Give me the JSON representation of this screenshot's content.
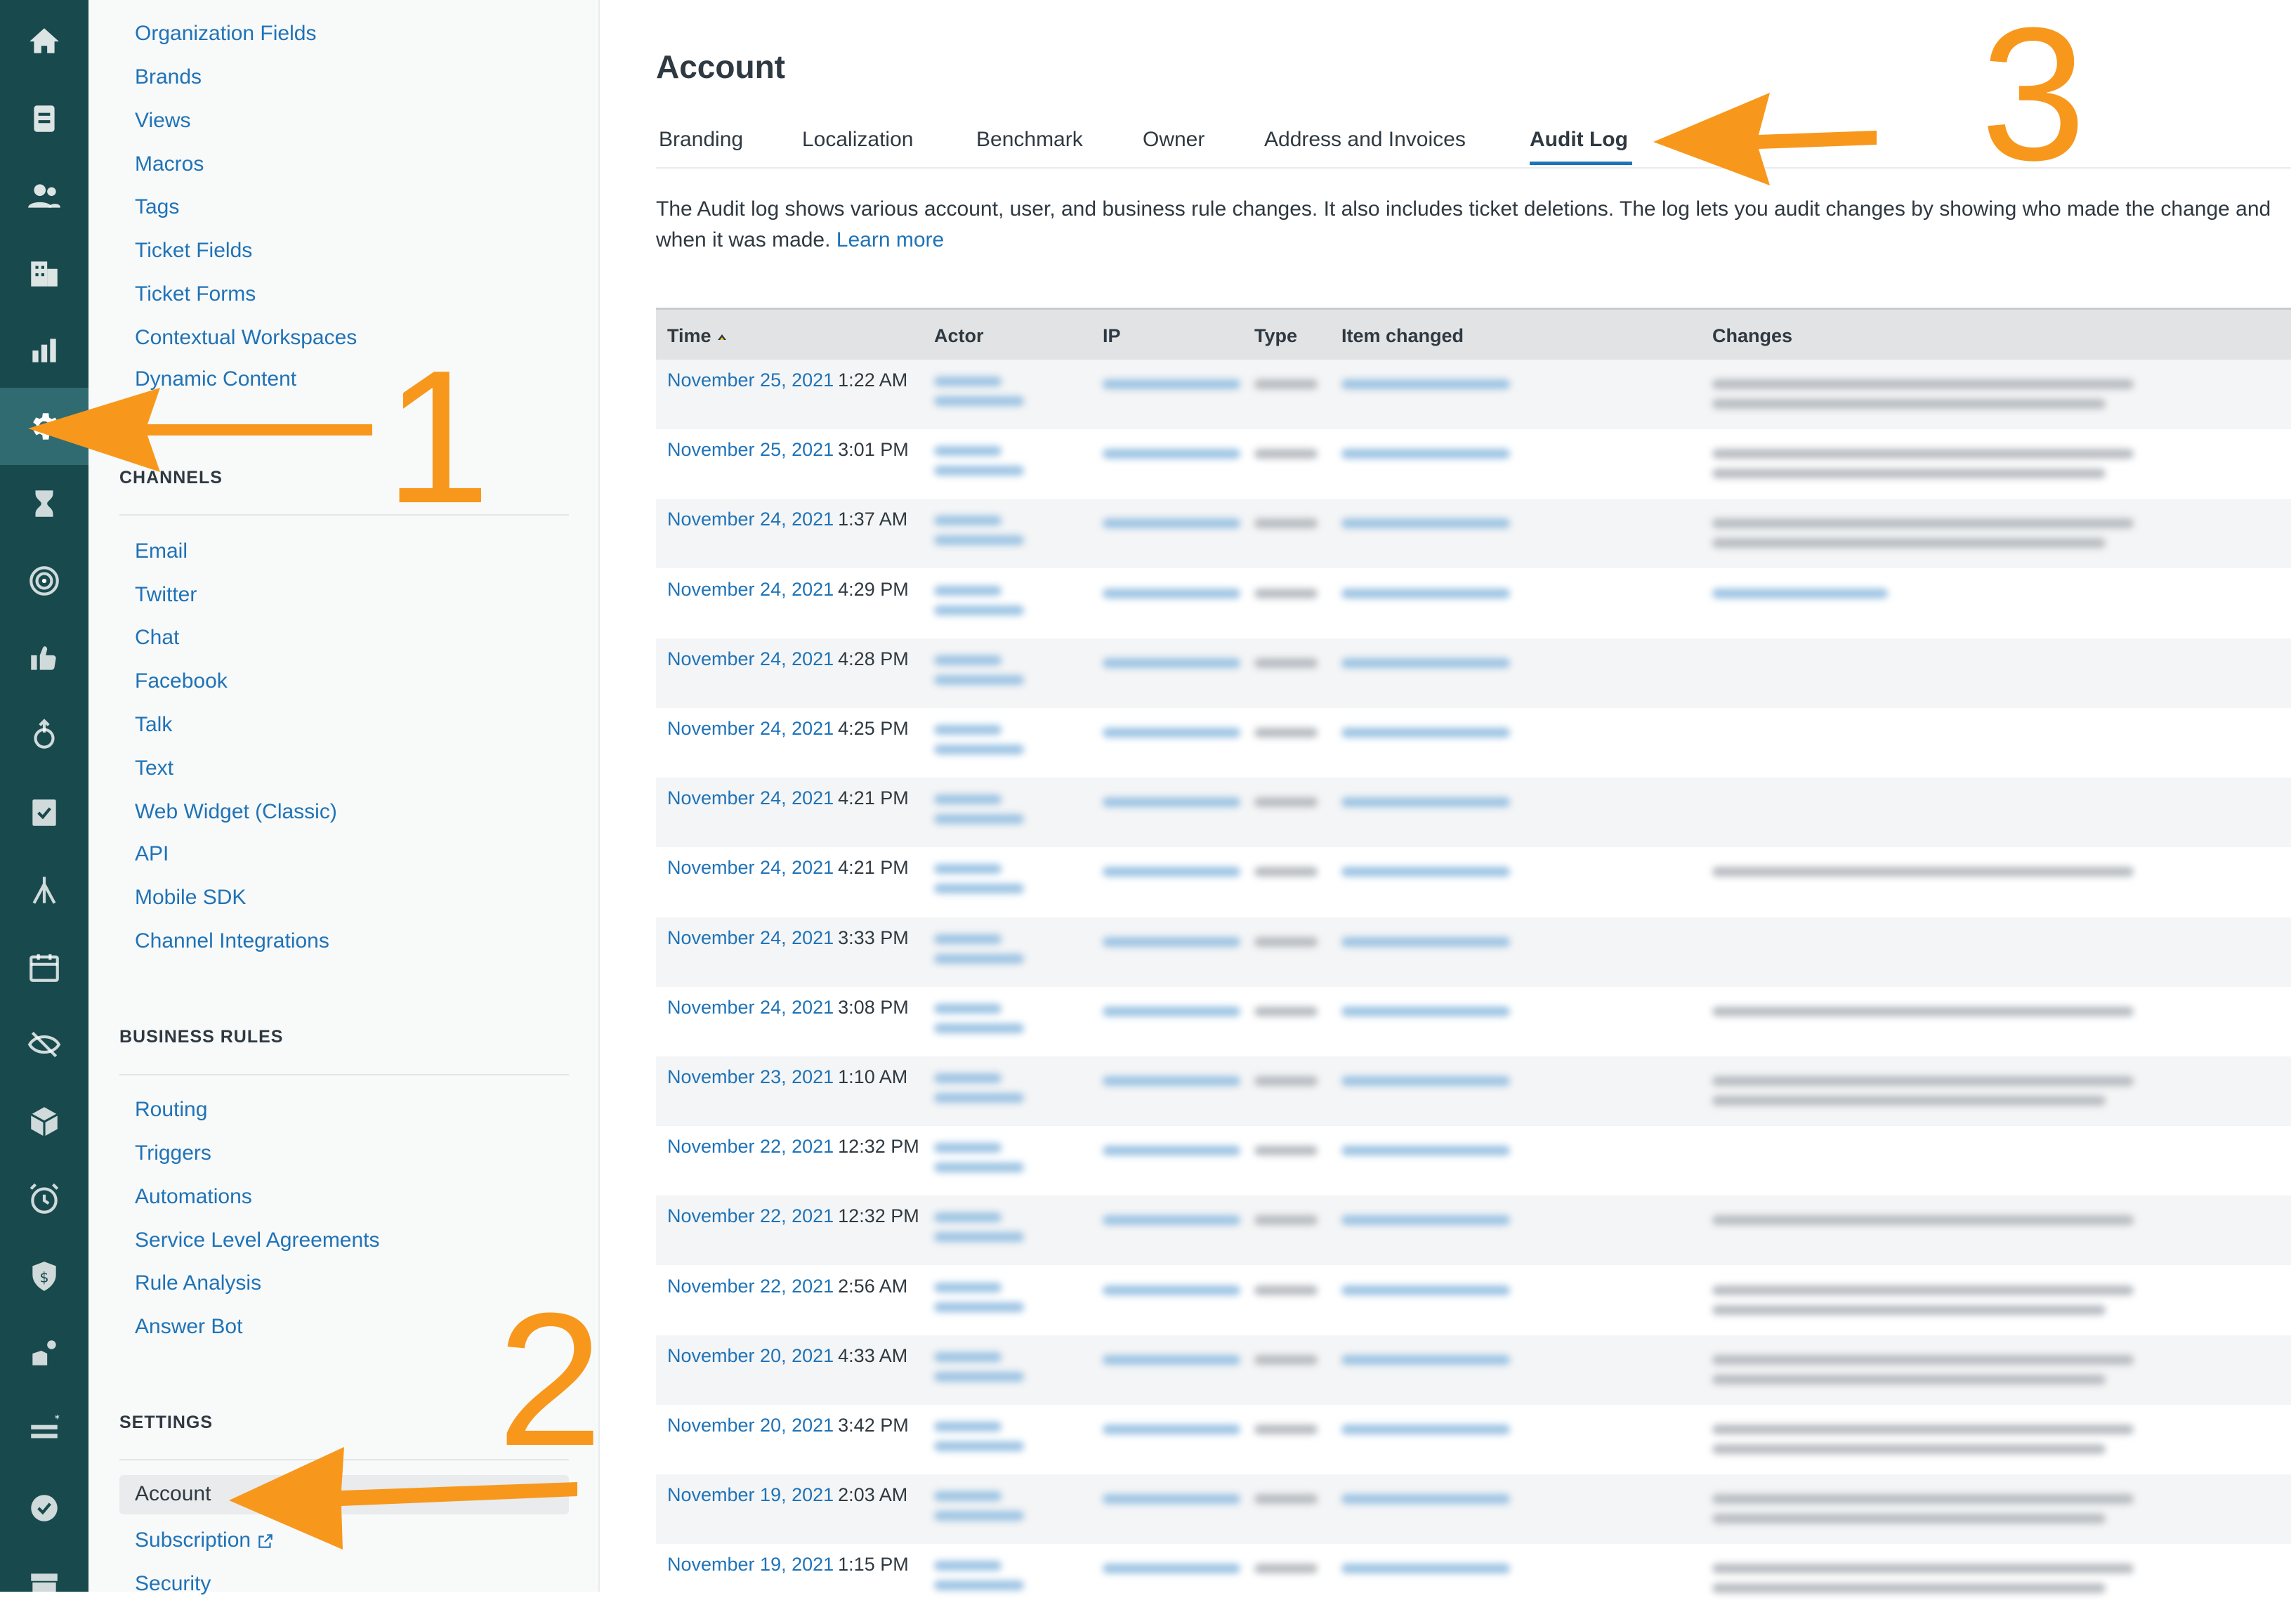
{
  "rail": {
    "icons": [
      "home-icon",
      "views-icon",
      "customers-icon",
      "organizations-icon",
      "reporting-icon",
      "admin-gear-icon",
      "hourglass-icon",
      "radar-icon",
      "thumbs-up-icon",
      "gesture-icon",
      "forms-icon",
      "tripod-icon",
      "calendar-icon",
      "eye-slash-icon",
      "box-icon",
      "alarm-clock-icon",
      "shield-dollar-icon",
      "hand-flowers-icon",
      "list-star-icon",
      "check-badge-icon",
      "storefront-icon"
    ],
    "active_index": 5
  },
  "nav": {
    "top_items": [
      "Organization Fields",
      "Brands",
      "Views",
      "Macros",
      "Tags",
      "Ticket Fields",
      "Ticket Forms",
      "Contextual Workspaces",
      "Dynamic Content"
    ],
    "channels_heading": "CHANNELS",
    "channels": [
      "Email",
      "Twitter",
      "Chat",
      "Facebook",
      "Talk",
      "Text",
      "Web Widget (Classic)",
      "API",
      "Mobile SDK",
      "Channel Integrations"
    ],
    "business_rules_heading": "BUSINESS RULES",
    "business_rules": [
      "Routing",
      "Triggers",
      "Automations",
      "Service Level Agreements",
      "Rule Analysis",
      "Answer Bot"
    ],
    "settings_heading": "SETTINGS",
    "settings": [
      "Account",
      "Subscription",
      "Security"
    ],
    "selected": "Account"
  },
  "page": {
    "title": "Account",
    "tabs": [
      "Branding",
      "Localization",
      "Benchmark",
      "Owner",
      "Address and Invoices",
      "Audit Log"
    ],
    "selected_tab": "Audit Log",
    "description": "The Audit log shows various account, user, and business rule changes. It also includes ticket deletions. The log lets you audit changes by showing who made the change and when it was made.",
    "learn_more": "Learn more"
  },
  "table": {
    "columns": [
      "Time",
      "Actor",
      "IP",
      "Type",
      "Item changed",
      "Changes"
    ],
    "sorted_column": "Time",
    "rows": [
      {
        "date": "November 25, 2021",
        "time": "1:22 AM",
        "changes_lines": 2,
        "item_link": true,
        "changes_link": false
      },
      {
        "date": "November 25, 2021",
        "time": "3:01 PM",
        "changes_lines": 2,
        "item_link": true,
        "changes_link": false
      },
      {
        "date": "November 24, 2021",
        "time": "1:37 AM",
        "changes_lines": 2,
        "item_link": true,
        "changes_link": false
      },
      {
        "date": "November 24, 2021",
        "time": "4:29 PM",
        "changes_lines": 1,
        "item_link": true,
        "changes_link": true
      },
      {
        "date": "November 24, 2021",
        "time": "4:28 PM",
        "changes_lines": 0,
        "item_link": true,
        "changes_link": false
      },
      {
        "date": "November 24, 2021",
        "time": "4:25 PM",
        "changes_lines": 0,
        "item_link": true,
        "changes_link": false
      },
      {
        "date": "November 24, 2021",
        "time": "4:21 PM",
        "changes_lines": 0,
        "item_link": true,
        "changes_link": false
      },
      {
        "date": "November 24, 2021",
        "time": "4:21 PM",
        "changes_lines": 1,
        "item_link": true,
        "changes_link": false
      },
      {
        "date": "November 24, 2021",
        "time": "3:33 PM",
        "changes_lines": 0,
        "item_link": true,
        "changes_link": false
      },
      {
        "date": "November 24, 2021",
        "time": "3:08 PM",
        "changes_lines": 1,
        "item_link": true,
        "changes_link": false
      },
      {
        "date": "November 23, 2021",
        "time": "1:10 AM",
        "changes_lines": 2,
        "item_link": true,
        "changes_link": false
      },
      {
        "date": "November 22, 2021",
        "time": "12:32 PM",
        "changes_lines": 0,
        "item_link": true,
        "changes_link": false
      },
      {
        "date": "November 22, 2021",
        "time": "12:32 PM",
        "changes_lines": 1,
        "item_link": true,
        "changes_link": false
      },
      {
        "date": "November 22, 2021",
        "time": "2:56 AM",
        "changes_lines": 2,
        "item_link": true,
        "changes_link": false
      },
      {
        "date": "November 20, 2021",
        "time": "4:33 AM",
        "changes_lines": 2,
        "item_link": true,
        "changes_link": false
      },
      {
        "date": "November 20, 2021",
        "time": "3:42 PM",
        "changes_lines": 2,
        "item_link": true,
        "changes_link": false
      },
      {
        "date": "November 19, 2021",
        "time": "2:03 AM",
        "changes_lines": 2,
        "item_link": true,
        "changes_link": false
      },
      {
        "date": "November 19, 2021",
        "time": "1:15 PM",
        "changes_lines": 2,
        "item_link": true,
        "changes_link": false
      }
    ]
  },
  "annotations": {
    "one": "1",
    "two": "2",
    "three": "3"
  },
  "colors": {
    "rail_bg": "#17494d",
    "link": "#1f73b7",
    "annotation": "#f7981d"
  }
}
